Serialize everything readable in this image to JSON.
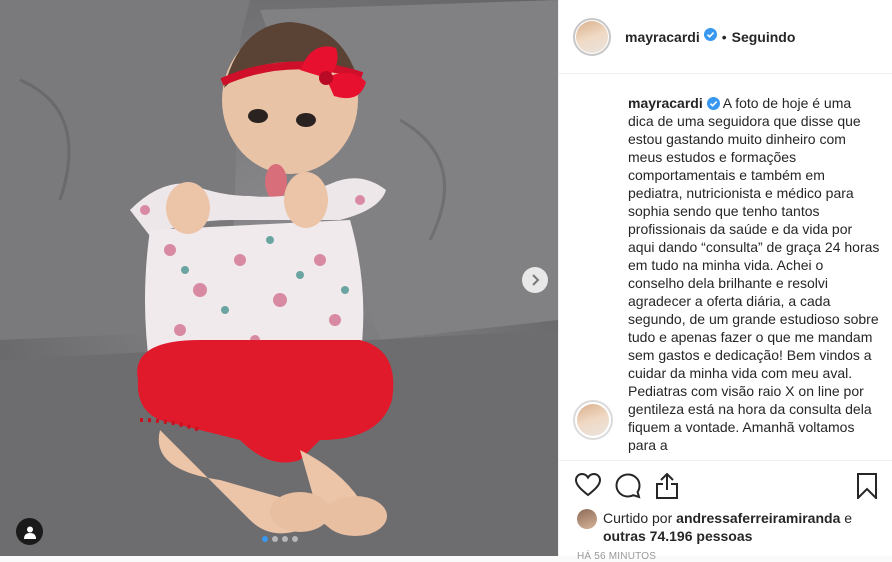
{
  "photo": {
    "next_icon": "chevron-right-icon",
    "tag_icon": "user-icon",
    "carousel_dots": 4,
    "active_dot": 0
  },
  "header": {
    "username": "mayracardi",
    "verified_icon": "verified-badge-icon",
    "separator": "•",
    "follow_status": "Seguindo"
  },
  "caption": {
    "username": "mayracardi",
    "text": "A foto de hoje é uma dica de uma seguidora que disse que estou gastando muito dinheiro com meus estudos e formações comportamentais e também em pediatra, nutricionista e médico para sophia sendo que tenho tantos profissionais da saúde e da vida por aqui dando “consulta” de graça 24 horas em tudo na minha vida. Achei o conselho dela brilhante e resolvi agradecer a oferta diária, a cada segundo, de um grande estudioso sobre tudo e apenas fazer o que me mandam sem gastos e dedicação! Bem vindos a cuidar da minha vida com meu aval. Pediatras com visão raio X on line por gentileza está na hora da consulta dela fiquem a vontade. Amanhã voltamos para a"
  },
  "actions": {
    "like_icon": "heart-icon",
    "comment_icon": "comment-icon",
    "share_icon": "share-icon",
    "save_icon": "bookmark-icon"
  },
  "likes": {
    "prefix": "Curtido por ",
    "user": "andressaferreiramiranda",
    "middle": " e ",
    "others": "outras 74.196 pessoas"
  },
  "timestamp": "HÁ 56 MINUTOS",
  "colors": {
    "accent": "#3897f0",
    "border": "#efefef"
  }
}
